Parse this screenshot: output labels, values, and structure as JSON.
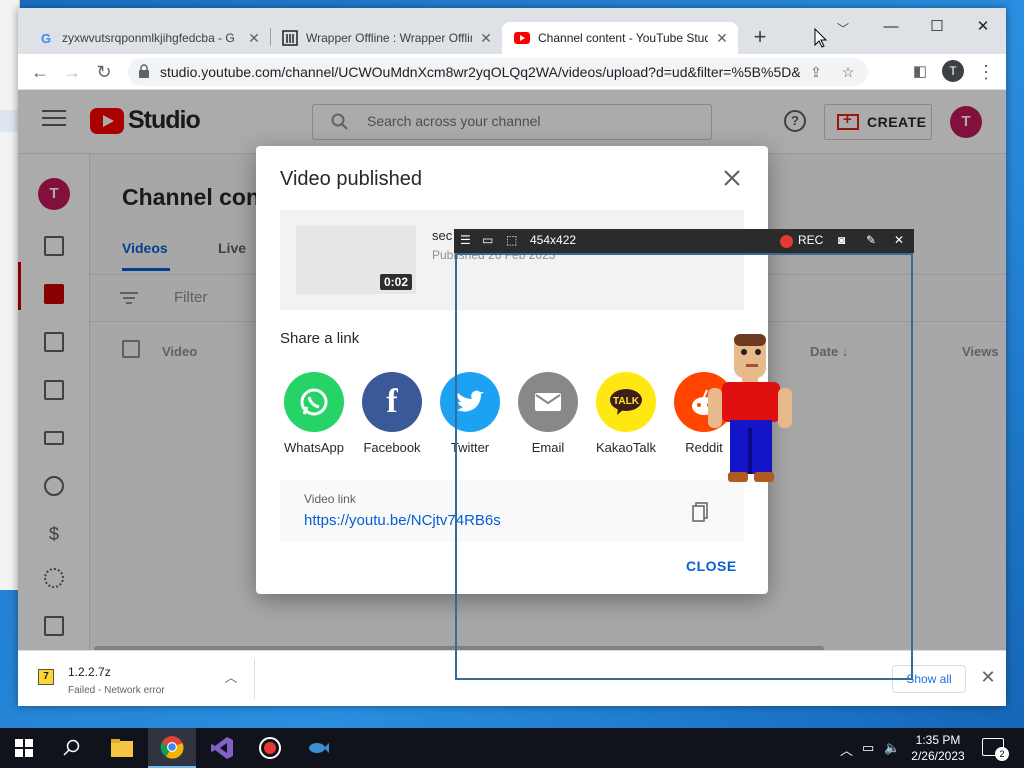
{
  "browser": {
    "tabs": [
      {
        "title": "zyxwvutsrqponmlkjihgfedcba - G",
        "icon": "google-icon"
      },
      {
        "title": "Wrapper Offline : Wrapper Offlin",
        "icon": "archive-icon"
      },
      {
        "title": "Channel content - YouTube Stud",
        "icon": "youtube-icon",
        "active": true
      }
    ],
    "url": "studio.youtube.com/channel/UCWOuMdnXcm8wr2yqOLQq2WA/videos/upload?d=ud&filter=%5B%5D&s...",
    "profile_initial": "T"
  },
  "studio": {
    "brand": "Studio",
    "search_placeholder": "Search across your channel",
    "create_label": "CREATE",
    "avatar_initial": "T",
    "page_title": "Channel content",
    "tabs": [
      "Videos",
      "Live"
    ],
    "filter_label": "Filter",
    "columns": {
      "video": "Video",
      "date": "Date",
      "views": "Views"
    }
  },
  "dialog": {
    "title": "Video published",
    "video": {
      "title": "sec",
      "published": "Published 26 Feb 2023",
      "duration": "0:02"
    },
    "share_label": "Share a link",
    "share_targets": [
      "WhatsApp",
      "Facebook",
      "Twitter",
      "Email",
      "KakaoTalk",
      "Reddit"
    ],
    "share_colors": {
      "whatsapp": "#25d366",
      "facebook": "#3b5998",
      "twitter": "#1da1f2",
      "email": "#888888",
      "kakaotalk": "#ffe812",
      "reddit": "#ff4500"
    },
    "link_label": "Video link",
    "link_url": "https://youtu.be/NCjtv74RB6s",
    "close_label": "CLOSE"
  },
  "recorder": {
    "size_readout": "454x422",
    "rec_label": "REC"
  },
  "downloads": {
    "file_name": "1.2.2.7z",
    "status": "Failed - Network error",
    "show_all": "Show all"
  },
  "taskbar": {
    "time": "1:35 PM",
    "date": "2/26/2023",
    "notifications": "2"
  },
  "colors": {
    "accent": "#065fd4",
    "youtube_red": "#ff0000",
    "avatar": "#c2185b"
  }
}
